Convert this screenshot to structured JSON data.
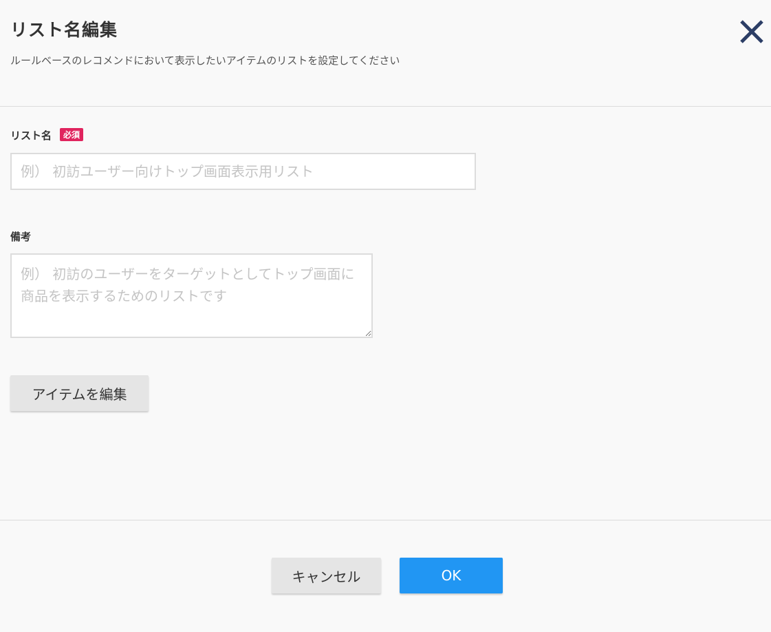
{
  "dialog": {
    "title": "リスト名編集",
    "subtitle": "ルールベースのレコメンドにおいて表示したいアイテムのリストを設定してください",
    "close_icon": "close-icon"
  },
  "form": {
    "list_name": {
      "label": "リスト名",
      "required_badge": "必須",
      "value": "",
      "placeholder": "例） 初訪ユーザー向けトップ画面表示用リスト"
    },
    "notes": {
      "label": "備考",
      "value": "",
      "placeholder": "例） 初訪のユーザーをターゲットとしてトップ画面に商品を表示するためのリストです"
    },
    "edit_items_label": "アイテムを編集"
  },
  "footer": {
    "cancel_label": "キャンセル",
    "ok_label": "OK"
  },
  "colors": {
    "accent": "#2196f3",
    "required": "#e0245e",
    "close_icon": "#2c3e66"
  }
}
